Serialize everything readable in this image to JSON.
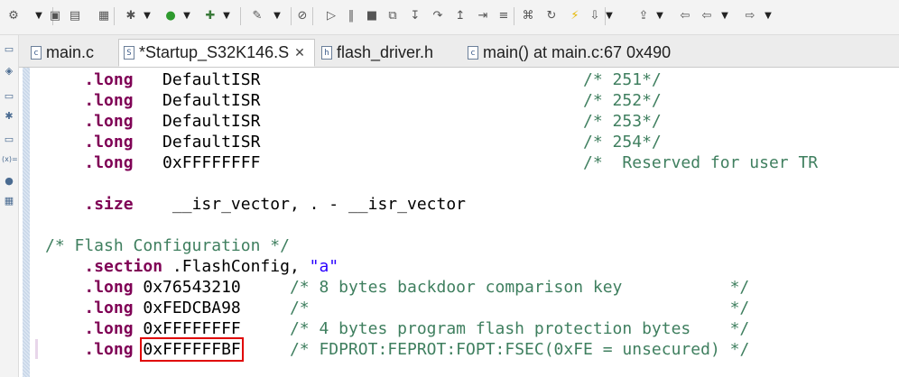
{
  "toolbar": {
    "items": [
      {
        "name": "debug-config-icon",
        "glyph": "⚙"
      },
      {
        "name": "dropdown-arrow",
        "glyph": "▼"
      },
      {
        "name": "save-icon",
        "glyph": "▣"
      },
      {
        "name": "save-all-icon",
        "glyph": "▤"
      },
      {
        "name": "binary-icon",
        "glyph": "▦"
      },
      {
        "name": "build-icon",
        "glyph": "✱"
      },
      {
        "name": "dropdown-arrow",
        "glyph": "▼"
      },
      {
        "name": "run-icon",
        "glyph": "●"
      },
      {
        "name": "dropdown-arrow",
        "glyph": "▼"
      },
      {
        "name": "debug-run-icon",
        "glyph": "✚"
      },
      {
        "name": "dropdown-arrow",
        "glyph": "▼"
      },
      {
        "name": "external-tool-icon",
        "glyph": "✎"
      },
      {
        "name": "dropdown-arrow",
        "glyph": "▼"
      },
      {
        "name": "skip-breakpoints-icon",
        "glyph": "⊘"
      },
      {
        "name": "resume-icon",
        "glyph": "▷"
      },
      {
        "name": "suspend-icon",
        "glyph": "‖"
      },
      {
        "name": "terminate-icon",
        "glyph": "■"
      },
      {
        "name": "disconnect-icon",
        "glyph": "⧉"
      },
      {
        "name": "step-into-icon",
        "glyph": "↧"
      },
      {
        "name": "step-over-icon",
        "glyph": "↷"
      },
      {
        "name": "step-return-icon",
        "glyph": "↥"
      },
      {
        "name": "instruction-step-icon",
        "glyph": "⇥"
      },
      {
        "name": "use-step-filters-icon",
        "glyph": "≡"
      },
      {
        "name": "reset-icon",
        "glyph": "⌘"
      },
      {
        "name": "restart-icon",
        "glyph": "↻"
      },
      {
        "name": "flash-icon",
        "glyph": "⚡"
      },
      {
        "name": "download-icon",
        "glyph": "⇩"
      },
      {
        "name": "dropdown-arrow",
        "glyph": "▼"
      },
      {
        "name": "upload-icon",
        "glyph": "⇪"
      },
      {
        "name": "dropdown-arrow",
        "glyph": "▼"
      },
      {
        "name": "last-edit-icon",
        "glyph": "⇦"
      },
      {
        "name": "back-icon",
        "glyph": "⇦"
      },
      {
        "name": "dropdown-arrow",
        "glyph": "▼"
      },
      {
        "name": "forward-icon",
        "glyph": "⇨"
      },
      {
        "name": "dropdown-arrow",
        "glyph": "▼"
      }
    ]
  },
  "rail": {
    "icons": [
      {
        "name": "minimize-icon",
        "glyph": "▭"
      },
      {
        "name": "project-explorer-icon",
        "glyph": "◈"
      },
      {
        "name": "minimize-icon",
        "glyph": "▭"
      },
      {
        "name": "debug-view-icon",
        "glyph": "✱"
      },
      {
        "name": "minimize-icon",
        "glyph": "▭"
      },
      {
        "name": "variables-icon",
        "glyph": "(x)="
      },
      {
        "name": "breakpoints-icon",
        "glyph": "●"
      },
      {
        "name": "modules-icon",
        "glyph": "▦"
      }
    ]
  },
  "tabs": [
    {
      "label": "main.c",
      "icon": "c",
      "closable": false
    },
    {
      "label": "*Startup_S32K146.S",
      "icon": "S",
      "closable": true,
      "close": "✕"
    },
    {
      "label": "flash_driver.h",
      "icon": "h",
      "closable": false
    },
    {
      "label": "main() at main.c:67 0x490",
      "icon": "c",
      "closable": false
    }
  ],
  "code": {
    "lines": [
      [
        {
          "t": "    "
        },
        {
          "t": ".long",
          "c": "kw"
        },
        {
          "t": "   DefaultISR                                 "
        },
        {
          "t": "/* 251*/",
          "c": "cm"
        }
      ],
      [
        {
          "t": "    "
        },
        {
          "t": ".long",
          "c": "kw"
        },
        {
          "t": "   DefaultISR                                 "
        },
        {
          "t": "/* 252*/",
          "c": "cm"
        }
      ],
      [
        {
          "t": "    "
        },
        {
          "t": ".long",
          "c": "kw"
        },
        {
          "t": "   DefaultISR                                 "
        },
        {
          "t": "/* 253*/",
          "c": "cm"
        }
      ],
      [
        {
          "t": "    "
        },
        {
          "t": ".long",
          "c": "kw"
        },
        {
          "t": "   DefaultISR                                 "
        },
        {
          "t": "/* 254*/",
          "c": "cm"
        }
      ],
      [
        {
          "t": "    "
        },
        {
          "t": ".long",
          "c": "kw"
        },
        {
          "t": "   0xFFFFFFFF                                 "
        },
        {
          "t": "/*  Reserved for user TR",
          "c": "cm"
        }
      ],
      [
        {
          "t": ""
        }
      ],
      [
        {
          "t": "    "
        },
        {
          "t": ".size",
          "c": "kw"
        },
        {
          "t": "    __isr_vector, . - __isr_vector"
        }
      ],
      [
        {
          "t": ""
        }
      ],
      [
        {
          "t": "/* Flash Configuration */",
          "c": "cm"
        }
      ],
      [
        {
          "t": "    "
        },
        {
          "t": ".section",
          "c": "kw"
        },
        {
          "t": " .FlashConfig, "
        },
        {
          "t": "\"a\"",
          "c": "st"
        }
      ],
      [
        {
          "t": "    "
        },
        {
          "t": ".long",
          "c": "kw"
        },
        {
          "t": " 0x76543210     "
        },
        {
          "t": "/* 8 bytes backdoor comparison key           */",
          "c": "cm"
        }
      ],
      [
        {
          "t": "    "
        },
        {
          "t": ".long",
          "c": "kw"
        },
        {
          "t": " 0xFEDCBA98     "
        },
        {
          "t": "/*                                           */",
          "c": "cm"
        }
      ],
      [
        {
          "t": "    "
        },
        {
          "t": ".long",
          "c": "kw"
        },
        {
          "t": " 0xFFFFFFFF     "
        },
        {
          "t": "/* 4 bytes program flash protection bytes    */",
          "c": "cm"
        }
      ],
      [
        {
          "t": "    "
        },
        {
          "t": ".long",
          "c": "kw"
        },
        {
          "t": " "
        },
        {
          "t": "0xFFFFFFBF",
          "hl": true
        },
        {
          "t": "     "
        },
        {
          "t": "/* FDPROT:FEPROT:FOPT:FSEC(0xFE = unsecured) */",
          "c": "cm"
        }
      ]
    ]
  }
}
